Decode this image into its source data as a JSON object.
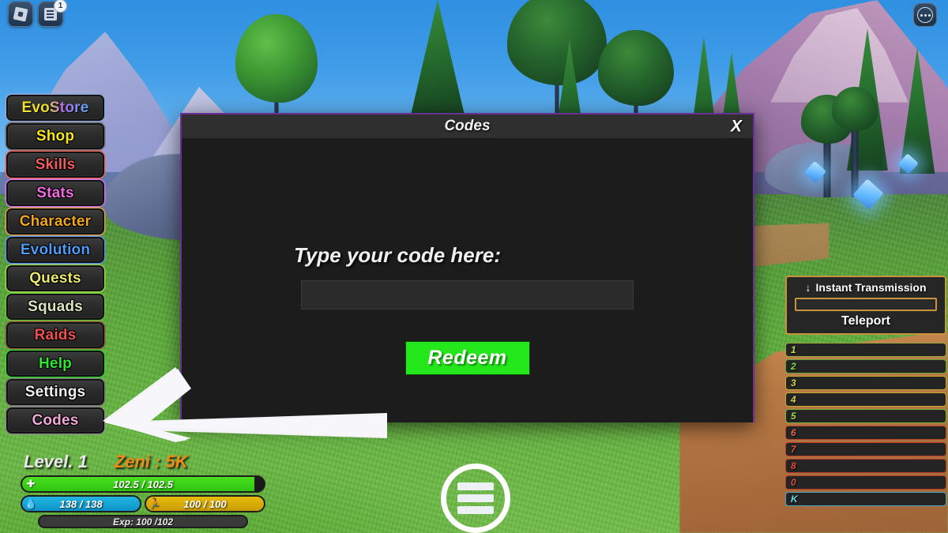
{
  "topbar": {
    "roblox_icon": "roblox-logo-icon",
    "chat_icon": "chat-icon",
    "chat_badge": "1",
    "menu_dots": "more-options-icon"
  },
  "sidebar": {
    "items": [
      {
        "label": "EvoStore",
        "color": "#f3e028",
        "color2": "#b06bf0",
        "border": "#8fa7d8",
        "gradient": true
      },
      {
        "label": "Shop",
        "color": "#f5e51e",
        "border": "#6f6f6f"
      },
      {
        "label": "Skills",
        "color": "#ef5d5d",
        "border": "#e8685f"
      },
      {
        "label": "Stats",
        "color": "#f06ae0",
        "border": "#cf79ef"
      },
      {
        "label": "Character",
        "color": "#f2a81c",
        "border": "#e0a24a"
      },
      {
        "label": "Evolution",
        "color": "#4d9cf5",
        "border": "#5e93e8"
      },
      {
        "label": "Quests",
        "color": "#eae86a",
        "border": "#9bd84a"
      },
      {
        "label": "Squads",
        "color": "#d8e6c0",
        "border": "#6fc23a"
      },
      {
        "label": "Raids",
        "color": "#f05050",
        "border": "#8a5a3a"
      },
      {
        "label": "Help",
        "color": "#2ee52e",
        "border": "#35d435"
      },
      {
        "label": "Settings",
        "color": "#f0f0f0",
        "border": "#7a7a7a"
      },
      {
        "label": "Codes",
        "color": "#f2a8d8",
        "border": "#8a8a8a"
      }
    ]
  },
  "modal": {
    "title": "Codes",
    "close_label": "X",
    "prompt": "Type your code here:",
    "input_value": "",
    "input_placeholder": "",
    "redeem_label": "Redeem",
    "border_color": "#6a2f96"
  },
  "hud": {
    "level": "Level. 1",
    "zeni": "Zeni : 5K",
    "health": {
      "text": "102.5  / 102.5",
      "icon": "health-cross-icon",
      "color": "#3ad019"
    },
    "ki": {
      "text": "138  / 138",
      "icon": "ki-droplet-icon",
      "color": "#18a9de"
    },
    "stamina": {
      "text": "100 / 100",
      "icon": "stamina-runner-icon",
      "color": "#e0b309"
    },
    "exp": {
      "text": "Exp: 100 /102"
    }
  },
  "bottom_menu": {
    "name": "hamburger-menu-button"
  },
  "right_panel": {
    "instant_transmission": {
      "arrow": "↓",
      "title": "Instant Transmission",
      "field_value": "",
      "teleport_label": "Teleport"
    },
    "slots": [
      {
        "key": "1",
        "color": "#c8e048",
        "border": "#9aab3c"
      },
      {
        "key": "2",
        "color": "#7ee048",
        "border": "#5ba832"
      },
      {
        "key": "3",
        "color": "#d8d048",
        "border": "#c8a82e"
      },
      {
        "key": "4",
        "color": "#d8d048",
        "border": "#c8a82e"
      },
      {
        "key": "5",
        "color": "#9ee048",
        "border": "#7ab83a"
      },
      {
        "key": "6",
        "color": "#e06848",
        "border": "#b8442a"
      },
      {
        "key": "7",
        "color": "#e85038",
        "border": "#c03a24"
      },
      {
        "key": "8",
        "color": "#e04838",
        "border": "#b83a28"
      },
      {
        "key": "0",
        "color": "#e04838",
        "border": "#b83a28"
      },
      {
        "key": "K",
        "color": "#6ad8e8",
        "border": "#4aa8c0"
      }
    ]
  },
  "annotation": {
    "arrow": "pointer-arrow-to-codes",
    "color": "#f4f4f8"
  }
}
